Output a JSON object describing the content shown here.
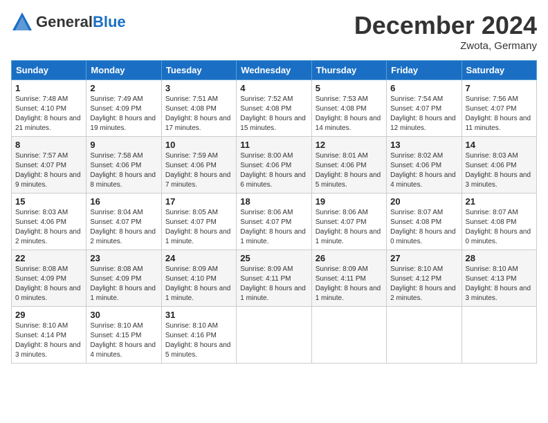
{
  "header": {
    "logo_general": "General",
    "logo_blue": "Blue",
    "month_title": "December 2024",
    "location": "Zwota, Germany"
  },
  "weekdays": [
    "Sunday",
    "Monday",
    "Tuesday",
    "Wednesday",
    "Thursday",
    "Friday",
    "Saturday"
  ],
  "weeks": [
    [
      {
        "day": "1",
        "sunrise": "7:48 AM",
        "sunset": "4:10 PM",
        "daylight": "8 hours and 21 minutes."
      },
      {
        "day": "2",
        "sunrise": "7:49 AM",
        "sunset": "4:09 PM",
        "daylight": "8 hours and 19 minutes."
      },
      {
        "day": "3",
        "sunrise": "7:51 AM",
        "sunset": "4:08 PM",
        "daylight": "8 hours and 17 minutes."
      },
      {
        "day": "4",
        "sunrise": "7:52 AM",
        "sunset": "4:08 PM",
        "daylight": "8 hours and 15 minutes."
      },
      {
        "day": "5",
        "sunrise": "7:53 AM",
        "sunset": "4:08 PM",
        "daylight": "8 hours and 14 minutes."
      },
      {
        "day": "6",
        "sunrise": "7:54 AM",
        "sunset": "4:07 PM",
        "daylight": "8 hours and 12 minutes."
      },
      {
        "day": "7",
        "sunrise": "7:56 AM",
        "sunset": "4:07 PM",
        "daylight": "8 hours and 11 minutes."
      }
    ],
    [
      {
        "day": "8",
        "sunrise": "7:57 AM",
        "sunset": "4:07 PM",
        "daylight": "8 hours and 9 minutes."
      },
      {
        "day": "9",
        "sunrise": "7:58 AM",
        "sunset": "4:06 PM",
        "daylight": "8 hours and 8 minutes."
      },
      {
        "day": "10",
        "sunrise": "7:59 AM",
        "sunset": "4:06 PM",
        "daylight": "8 hours and 7 minutes."
      },
      {
        "day": "11",
        "sunrise": "8:00 AM",
        "sunset": "4:06 PM",
        "daylight": "8 hours and 6 minutes."
      },
      {
        "day": "12",
        "sunrise": "8:01 AM",
        "sunset": "4:06 PM",
        "daylight": "8 hours and 5 minutes."
      },
      {
        "day": "13",
        "sunrise": "8:02 AM",
        "sunset": "4:06 PM",
        "daylight": "8 hours and 4 minutes."
      },
      {
        "day": "14",
        "sunrise": "8:03 AM",
        "sunset": "4:06 PM",
        "daylight": "8 hours and 3 minutes."
      }
    ],
    [
      {
        "day": "15",
        "sunrise": "8:03 AM",
        "sunset": "4:06 PM",
        "daylight": "8 hours and 2 minutes."
      },
      {
        "day": "16",
        "sunrise": "8:04 AM",
        "sunset": "4:07 PM",
        "daylight": "8 hours and 2 minutes."
      },
      {
        "day": "17",
        "sunrise": "8:05 AM",
        "sunset": "4:07 PM",
        "daylight": "8 hours and 1 minute."
      },
      {
        "day": "18",
        "sunrise": "8:06 AM",
        "sunset": "4:07 PM",
        "daylight": "8 hours and 1 minute."
      },
      {
        "day": "19",
        "sunrise": "8:06 AM",
        "sunset": "4:07 PM",
        "daylight": "8 hours and 1 minute."
      },
      {
        "day": "20",
        "sunrise": "8:07 AM",
        "sunset": "4:08 PM",
        "daylight": "8 hours and 0 minutes."
      },
      {
        "day": "21",
        "sunrise": "8:07 AM",
        "sunset": "4:08 PM",
        "daylight": "8 hours and 0 minutes."
      }
    ],
    [
      {
        "day": "22",
        "sunrise": "8:08 AM",
        "sunset": "4:09 PM",
        "daylight": "8 hours and 0 minutes."
      },
      {
        "day": "23",
        "sunrise": "8:08 AM",
        "sunset": "4:09 PM",
        "daylight": "8 hours and 1 minute."
      },
      {
        "day": "24",
        "sunrise": "8:09 AM",
        "sunset": "4:10 PM",
        "daylight": "8 hours and 1 minute."
      },
      {
        "day": "25",
        "sunrise": "8:09 AM",
        "sunset": "4:11 PM",
        "daylight": "8 hours and 1 minute."
      },
      {
        "day": "26",
        "sunrise": "8:09 AM",
        "sunset": "4:11 PM",
        "daylight": "8 hours and 1 minute."
      },
      {
        "day": "27",
        "sunrise": "8:10 AM",
        "sunset": "4:12 PM",
        "daylight": "8 hours and 2 minutes."
      },
      {
        "day": "28",
        "sunrise": "8:10 AM",
        "sunset": "4:13 PM",
        "daylight": "8 hours and 3 minutes."
      }
    ],
    [
      {
        "day": "29",
        "sunrise": "8:10 AM",
        "sunset": "4:14 PM",
        "daylight": "8 hours and 3 minutes."
      },
      {
        "day": "30",
        "sunrise": "8:10 AM",
        "sunset": "4:15 PM",
        "daylight": "8 hours and 4 minutes."
      },
      {
        "day": "31",
        "sunrise": "8:10 AM",
        "sunset": "4:16 PM",
        "daylight": "8 hours and 5 minutes."
      },
      null,
      null,
      null,
      null
    ]
  ]
}
